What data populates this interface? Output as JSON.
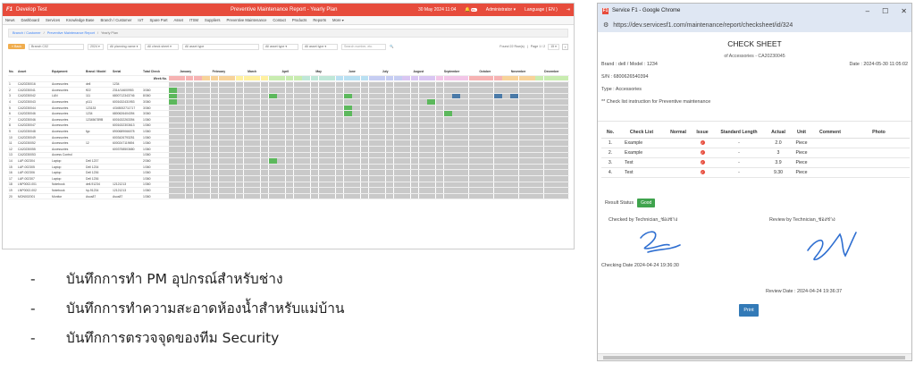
{
  "left": {
    "topbar": {
      "logo": "F1",
      "app_title": "Develop Test",
      "report_title": "Preventive Maintenance Report - Yearly Plan",
      "date": "30 May 2024 11:04",
      "user": "Administrator ▾",
      "badge": "99+",
      "language": "Language ( EN )"
    },
    "nav": [
      "News",
      "Dashboard",
      "Services",
      "Knowledge Base",
      "Branch / Customer",
      "IoT",
      "Spare Part",
      "Asset",
      "ITSM",
      "Suppliers",
      "Preventive Maintenance",
      "Contact",
      "Products",
      "Reports",
      "More ▾"
    ],
    "breadcrumb": {
      "a": "Branch / Customer",
      "b": "Preventive Maintenance Report",
      "c": "Yearly Plan"
    },
    "filters": {
      "back": "« Back",
      "branch": "Branch C02",
      "year": "2024 ▾",
      "f1": "All planning name ▾",
      "f2": "All check sheet ▾",
      "f3": "All asset type",
      "f4": "All asset type ▾",
      "f5": "All asset type ▾",
      "search_placeholder": "Search number, etc.",
      "found": "Found 22 Row(s)",
      "page": "Page 1 / 2",
      "per": "15 ▾"
    },
    "headers": [
      "No.",
      "Asset",
      "Equipment",
      "Brand / Model",
      "Serial",
      "Total Check",
      "Week No."
    ],
    "months": [
      "January",
      "February",
      "March",
      "April",
      "May",
      "June",
      "July",
      "August",
      "September",
      "October",
      "November",
      "December"
    ],
    "rows": [
      [
        "1",
        "CA20230016",
        "Accessories",
        "dell",
        "1234",
        ""
      ],
      [
        "2",
        "CA20230041",
        "Accessories",
        "ff22",
        "2314/14600953",
        "3/360"
      ],
      [
        "3",
        "CA20230042",
        "LAN",
        "111",
        "6800712343746",
        "8/360"
      ],
      [
        "4",
        "CA20230043",
        "Accessories",
        "p111",
        "6001632431953",
        "3/360"
      ],
      [
        "5",
        "CA20230044",
        "Accessories",
        "123133",
        "4/345002711717",
        "3/360"
      ],
      [
        "6",
        "CA20230046",
        "Accessories",
        "1234",
        "6800626404394",
        "3/360"
      ],
      [
        "7",
        "CA20230046",
        "Accessories",
        "123456789B",
        "6001632263394",
        "1/360"
      ],
      [
        "8",
        "CA20230047",
        "Accessories",
        "",
        "6001632303613",
        "1/360"
      ],
      [
        "9",
        "CA20230048",
        "Accessories",
        "fgc",
        "6900689066078",
        "1/360"
      ],
      [
        "10",
        "CA20230049",
        "Accessories",
        "",
        "6003426793251",
        "1/360"
      ],
      [
        "11",
        "CA20230052",
        "Accessories",
        "12",
        "6000247119694",
        "1/360"
      ],
      [
        "12",
        "CA20230055",
        "Accessories",
        "",
        "6003758503680",
        "1/360"
      ],
      [
        "13",
        "CA20230053",
        "Access Control",
        "",
        "",
        "1/360"
      ],
      [
        "14",
        "LAP-002304",
        "Laptop",
        "Dell 1237",
        "",
        "2/360"
      ],
      [
        "15",
        "LAP-002305",
        "Laptop",
        "Dell 1234",
        "",
        "1/360"
      ],
      [
        "16",
        "LAP-002306",
        "Laptop",
        "Dell 1236",
        "",
        "1/360"
      ],
      [
        "17",
        "LAP-002307",
        "Laptop",
        "Dell 1236",
        "",
        "1/360"
      ],
      [
        "18",
        "LNP0002-001",
        "Notebook",
        "dell-91234",
        "12121213",
        "1/360"
      ],
      [
        "19",
        "LNP0002-002",
        "Notebook",
        "hp-91234",
        "12121213",
        "1/360"
      ],
      [
        "20",
        "MON002001",
        "Monitor",
        "Asus87",
        "Asus87",
        "1/360"
      ]
    ]
  },
  "bullets": [
    "บันทึกการทำ PM อุปกรณ์สำหรับช่าง",
    "บันทึกการทำความสะอาดห้องน้ำสำหรับแม่บ้าน",
    "บันทึกการตรวจจุดของทีม Security"
  ],
  "right": {
    "window_title": "Service F1 - Google Chrome",
    "favicon": "F1",
    "url": "https://dev.servicesf1.com/maintenance/report/checksheet/id/324",
    "title": "CHECK SHEET",
    "subtitle": "of Accessories - CA20230045",
    "brand": "Brand : dell / Model : 1234",
    "date": "Date : 2024-05-30 11:05:02",
    "sn": "S/N : 6800626540394",
    "type": "Type : Accessories",
    "instruction": "** Check list instruction for Preventive maintenance",
    "table_headers": [
      "No.",
      "Check List",
      "Normal",
      "Issue",
      "Standard Length",
      "Actual",
      "Unit",
      "Comment",
      "Photo"
    ],
    "rows": [
      {
        "no": "1.",
        "item": "Example",
        "std": "-",
        "actual": "2.0",
        "unit": "Piece"
      },
      {
        "no": "2.",
        "item": "Example",
        "std": "-",
        "actual": "3",
        "unit": "Piece"
      },
      {
        "no": "3.",
        "item": "Test",
        "std": "-",
        "actual": "3.9",
        "unit": "Piece"
      },
      {
        "no": "4.",
        "item": "Test",
        "std": "-",
        "actual": "9.30",
        "unit": "Piece"
      }
    ],
    "result_label": "Result Status",
    "result_value": "Good",
    "checked_by": "Checked by   Technician_ช่องช่าง",
    "review_by": "Review by   Technician_ช่องช่าง",
    "checking_date": "Checking Date   2024-04-24 19:36:30",
    "review_date": "Review Date :   2024-04-24 19:36:37",
    "print": "Print"
  }
}
